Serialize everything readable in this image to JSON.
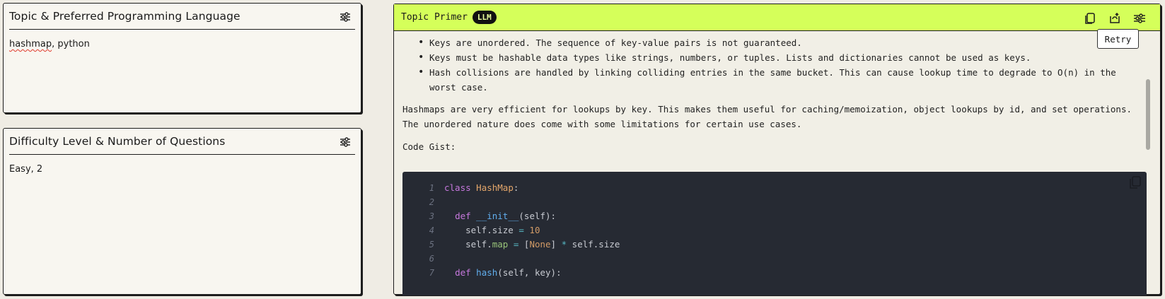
{
  "topic_card": {
    "title": "Topic & Preferred Programming Language",
    "value_misspelled": "hashmap",
    "value_rest": ", python"
  },
  "difficulty_card": {
    "title": "Difficulty Level & Number of Questions",
    "value": "Easy, 2"
  },
  "primer": {
    "title": "Topic Primer",
    "badge": "LLM",
    "tooltip": "Retry",
    "icons": [
      "copy-icon",
      "retry-icon",
      "settings-icon"
    ],
    "bullets": [
      "Keys are unordered. The sequence of key-value pairs is not guaranteed.",
      "Keys must be hashable data types like strings, numbers, or tuples. Lists and dictionaries cannot be used as keys.",
      "Hash collisions are handled by linking colliding entries in the same bucket. This can cause lookup time to degrade to O(n) in the worst case."
    ],
    "paragraph": "Hashmaps are very efficient for lookups by key. This makes them useful for caching/memoization, object lookups by id, and set operations. The unordered nature does come with some limitations for certain use cases.",
    "gist_label": "Code Gist:",
    "code_lines": [
      {
        "n": "1",
        "text": "class HashMap:"
      },
      {
        "n": "2",
        "text": ""
      },
      {
        "n": "3",
        "text": "  def __init__(self):"
      },
      {
        "n": "4",
        "text": "    self.size = 10"
      },
      {
        "n": "5",
        "text": "    self.map = [None] * self.size"
      },
      {
        "n": "6",
        "text": ""
      },
      {
        "n": "7",
        "text": "  def hash(self, key):"
      }
    ]
  }
}
